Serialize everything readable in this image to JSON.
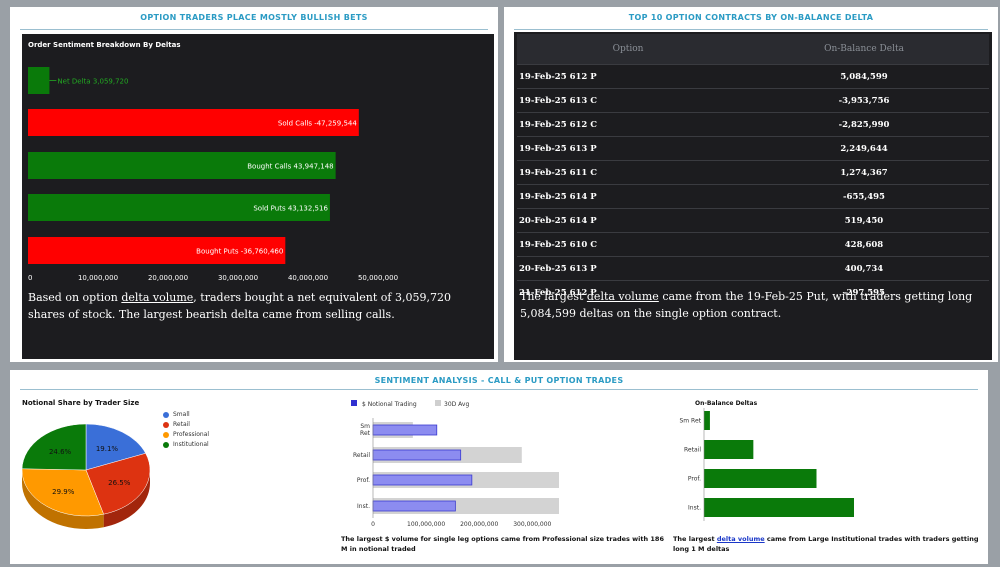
{
  "panels": {
    "top_left_title": "OPTION TRADERS PLACE MOSTLY BULLISH BETS",
    "top_right_title": "TOP 10 OPTION CONTRACTS BY ON-BALANCE DELTA",
    "bottom_title": "SENTIMENT ANALYSIS - CALL & PUT OPTION TRADES"
  },
  "colors": {
    "green": "#0a7a0a",
    "red": "#ff0000",
    "blue": "#3a6fd8",
    "orange": "#ff9900",
    "rust": "#dd3311",
    "purple": "#7b7be8",
    "grey": "#d3d3d3"
  },
  "sentiment_chart": {
    "title": "Order Sentiment Breakdown By Deltas",
    "caption_pre": "Based on option ",
    "caption_link": "delta volume",
    "caption_post": ", traders bought a net equivalent of 3,059,720 shares of stock. The largest bearish delta came from selling calls.",
    "ticks": [
      "0",
      "10,000,000",
      "20,000,000",
      "30,000,000",
      "40,000,000",
      "50,000,000"
    ]
  },
  "top_table": {
    "headers": [
      "Option",
      "On-Balance Delta"
    ],
    "rows": [
      [
        "19-Feb-25 612 P",
        "5,084,599"
      ],
      [
        "19-Feb-25 613 C",
        "-3,953,756"
      ],
      [
        "19-Feb-25 612 C",
        "-2,825,990"
      ],
      [
        "19-Feb-25 613 P",
        "2,249,644"
      ],
      [
        "19-Feb-25 611 C",
        "1,274,367"
      ],
      [
        "19-Feb-25 614 P",
        "-655,495"
      ],
      [
        "20-Feb-25 614 P",
        "519,450"
      ],
      [
        "19-Feb-25 610 C",
        "428,608"
      ],
      [
        "20-Feb-25 613 P",
        "400,734"
      ],
      [
        "21-Feb-25 612 P",
        "-297,595"
      ]
    ],
    "caption_pre": "The largest ",
    "caption_link": "delta volume",
    "caption_post": " came from the 19-Feb-25 Put, with traders getting long 5,084,599 deltas on the single option contract."
  },
  "pie": {
    "title": "Notional Share by Trader Size",
    "legend": [
      "Small",
      "Retail",
      "Professional",
      "Institutional"
    ]
  },
  "notional": {
    "legend": [
      "$ Notional Trading",
      "30D Avg"
    ],
    "ticks": [
      "0",
      "100,000,000",
      "200,000,000",
      "300,000,000"
    ],
    "caption": "The largest $ volume for single leg options came from Professional size trades with 186 M in notional traded"
  },
  "obd": {
    "title": "On-Balance Deltas",
    "caption_pre": "The largest ",
    "caption_link": "delta volume",
    "caption_post": " came from Large Institutional trades with traders getting long 1 M deltas"
  },
  "chart_data": [
    {
      "type": "bar",
      "title": "Order Sentiment Breakdown By Deltas",
      "categories": [
        "Net Delta",
        "Sold Calls",
        "Bought Calls",
        "Sold Puts",
        "Bought Puts"
      ],
      "values": [
        3059720,
        -47259544,
        43947148,
        43132516,
        -36760460
      ],
      "labels": [
        "Net Delta 3,059,720",
        "Sold Calls -47,259,544",
        "Bought Calls 43,947,148",
        "Sold Puts 43,132,516",
        "Bought Puts -36,760,460"
      ],
      "xlim": [
        0,
        50000000
      ]
    },
    {
      "type": "pie",
      "title": "Notional Share by Trader Size",
      "categories": [
        "Small",
        "Retail",
        "Professional",
        "Institutional"
      ],
      "values": [
        19.1,
        26.5,
        29.9,
        24.6
      ],
      "labels": [
        "19.1%",
        "26.5%",
        "29.9%",
        "24.6%"
      ]
    },
    {
      "type": "bar",
      "categories": [
        "Sm Ret",
        "Retail",
        "Prof.",
        "Inst."
      ],
      "series": [
        {
          "name": "$ Notional Trading",
          "values": [
            120000000,
            165000000,
            186000000,
            155000000
          ]
        },
        {
          "name": "30D Avg",
          "values": [
            75000000,
            280000000,
            350000000,
            350000000
          ]
        }
      ],
      "xlim": [
        0,
        350000000
      ]
    },
    {
      "type": "bar",
      "title": "On-Balance Deltas",
      "categories": [
        "Sm Ret",
        "Retail",
        "Prof.",
        "Inst."
      ],
      "values": [
        30000,
        250000,
        570000,
        760000
      ]
    }
  ]
}
